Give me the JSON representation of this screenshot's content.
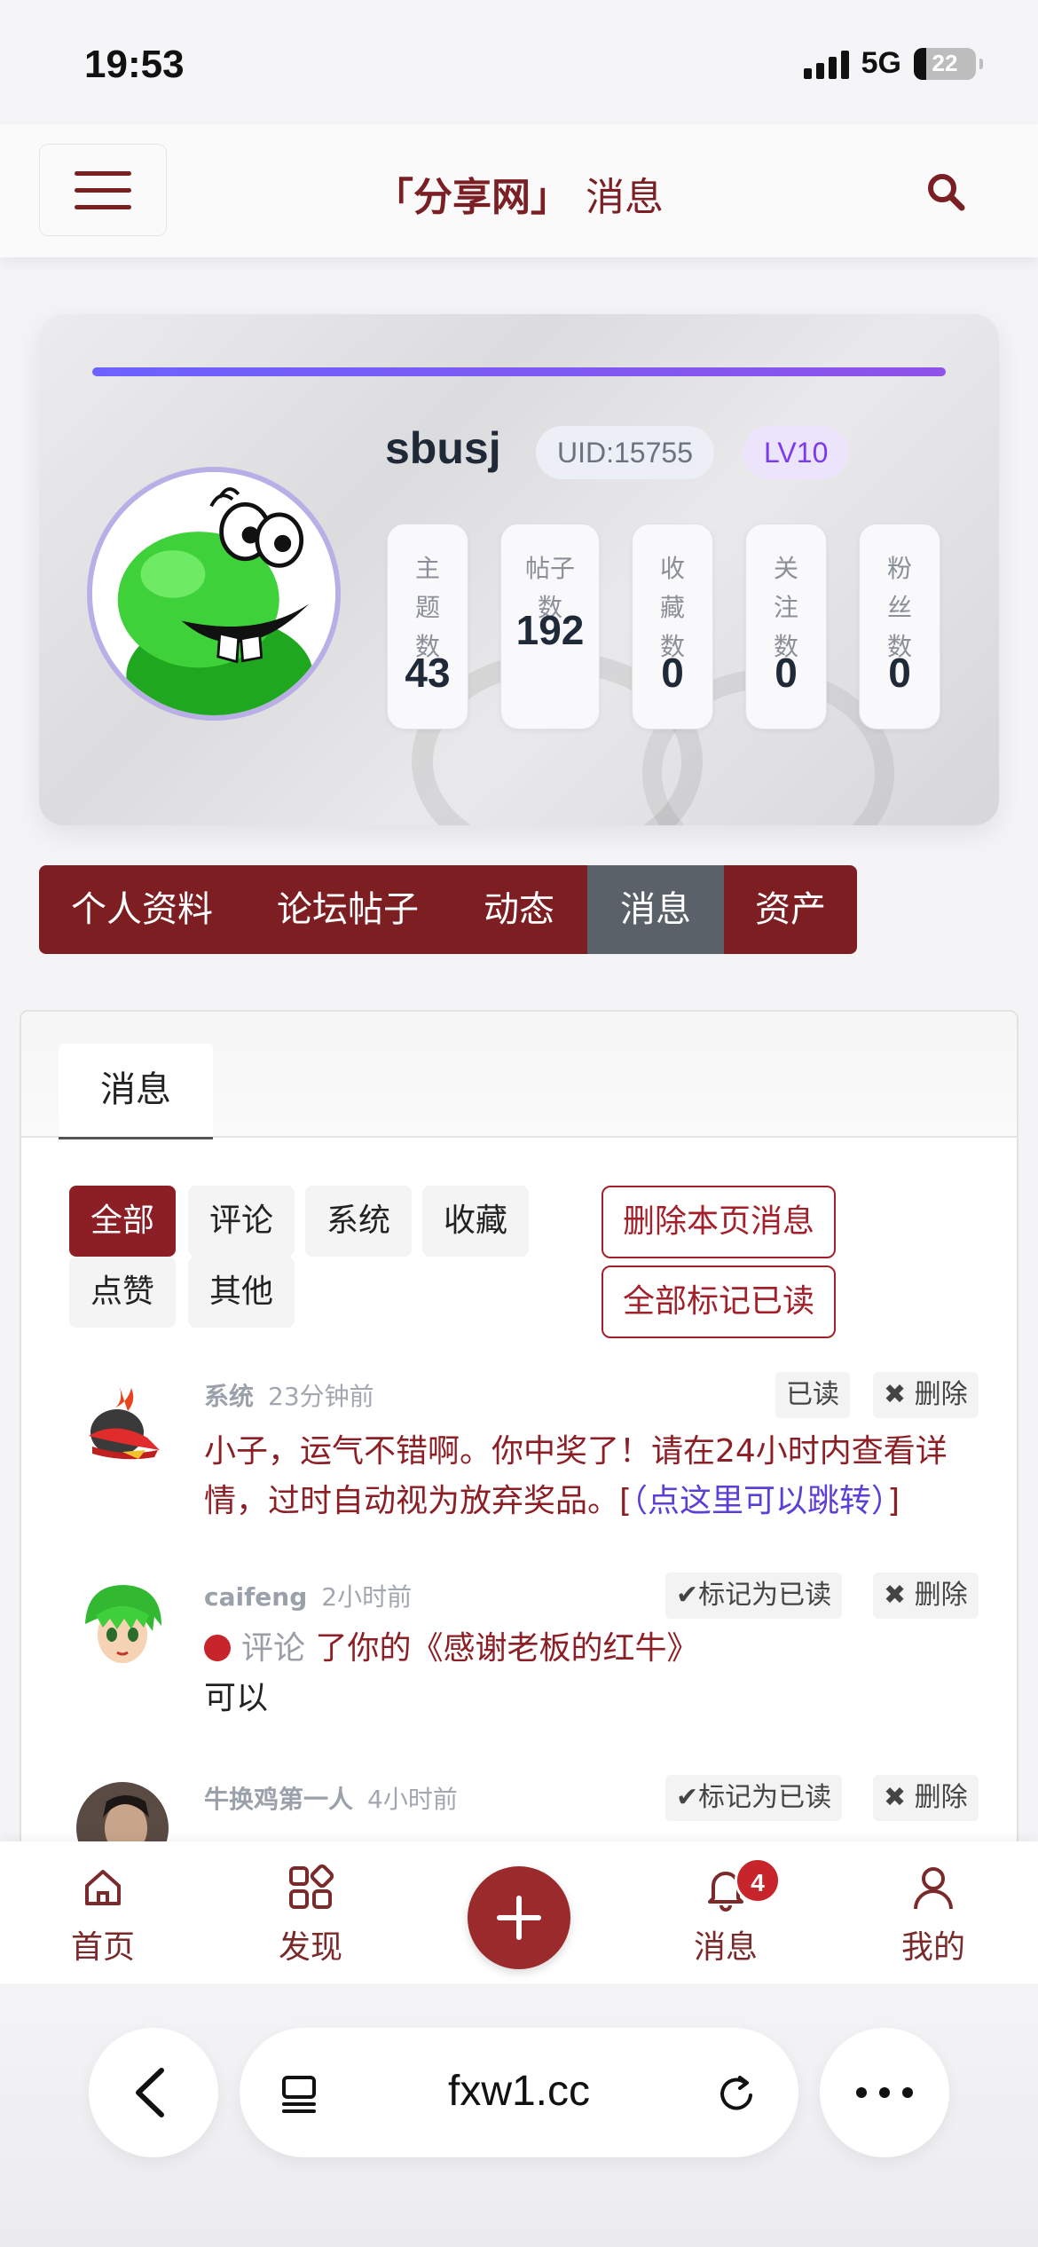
{
  "status_bar": {
    "time": "19:53",
    "network": "5G",
    "battery": "22"
  },
  "header": {
    "site": "「分享网」",
    "section": "消息"
  },
  "profile": {
    "username": "sbusj",
    "uid": "UID:15755",
    "level": "LV10",
    "level_progress": 1.0,
    "stats": [
      {
        "label": "主题数",
        "value": "43"
      },
      {
        "label": "帖子数",
        "value": "192"
      },
      {
        "label": "收藏数",
        "value": "0"
      },
      {
        "label": "关注数",
        "value": "0"
      },
      {
        "label": "粉丝数",
        "value": "0"
      }
    ]
  },
  "main_tabs": [
    {
      "label": "个人资料",
      "active": false
    },
    {
      "label": "论坛帖子",
      "active": false
    },
    {
      "label": "动态",
      "active": false
    },
    {
      "label": "消息",
      "active": true
    },
    {
      "label": "资产",
      "active": false
    }
  ],
  "panel": {
    "tab": "消息",
    "filters": [
      {
        "label": "全部",
        "active": true
      },
      {
        "label": "评论",
        "active": false
      },
      {
        "label": "系统",
        "active": false
      },
      {
        "label": "收藏",
        "active": false
      },
      {
        "label": "点赞",
        "active": false
      },
      {
        "label": "其他",
        "active": false
      }
    ],
    "actions": {
      "delete_page": "删除本页消息",
      "mark_all_read": "全部标记已读"
    },
    "messages": [
      {
        "sender": "系统",
        "time": "23分钟前",
        "status": "已读",
        "delete": "✖ 删除",
        "text": "小子，运气不错啊。你中奖了！请在24小时内查看详情，过时自动视为放弃奖品。[",
        "link": "（点这里可以跳转）",
        "text_end": "]"
      },
      {
        "sender": "caifeng",
        "time": "2小时前",
        "status": "✔标记为已读",
        "delete": "✖ 删除",
        "action": "评论",
        "text": "了你的《感谢老板的红牛》",
        "reply": "可以"
      },
      {
        "sender": "牛换鸡第一人",
        "time": "4小时前",
        "status": "✔标记为已读",
        "delete": "✖ 删除"
      }
    ]
  },
  "bottom_nav": [
    {
      "label": "首页",
      "icon": "home-icon"
    },
    {
      "label": "发现",
      "icon": "discover-icon"
    },
    {
      "label": "",
      "icon": "plus-icon"
    },
    {
      "label": "消息",
      "icon": "bell-icon",
      "badge": "4"
    },
    {
      "label": "我的",
      "icon": "user-icon"
    }
  ],
  "browser": {
    "url": "fxw1.cc"
  },
  "colors": {
    "brand": "#7d1f22",
    "active_tab": "#5b6169",
    "link": "#5b3fd6",
    "level_bar": "#6c63ff"
  }
}
